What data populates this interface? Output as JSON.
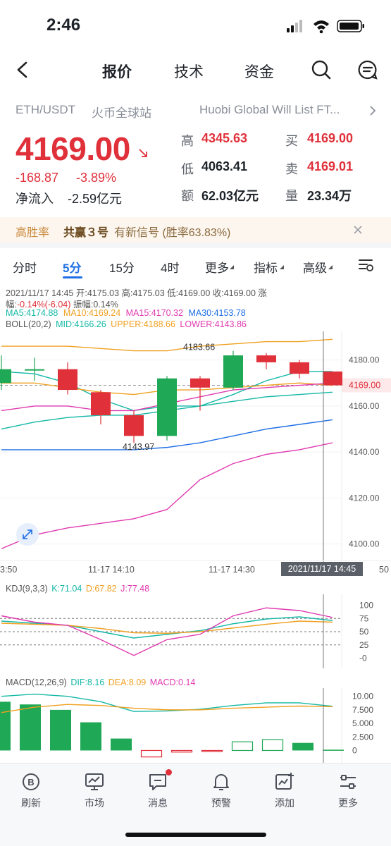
{
  "status": {
    "time": "2:46"
  },
  "nav": {
    "tabs": [
      "报价",
      "技术",
      "资金"
    ]
  },
  "header": {
    "pair": "ETH/USDT",
    "exchange": "火币全球站",
    "news": "Huobi Global Will List FT...",
    "price": "4169.00",
    "change": "-168.87",
    "change_pct": "-3.89%",
    "net_inflow_label": "净流入",
    "net_inflow": "-2.59亿元",
    "stats": {
      "high_label": "高",
      "high": "4345.63",
      "low_label": "低",
      "low": "4063.41",
      "amount_label": "额",
      "amount": "62.03亿元",
      "buy_label": "买",
      "buy": "4169.00",
      "sell_label": "卖",
      "sell": "4169.01",
      "volume_label": "量",
      "volume": "23.34万"
    }
  },
  "signal": {
    "tag": "高胜率",
    "name": "共赢３号",
    "text": "有新信号 (胜率63.83%)"
  },
  "chart_tabs": [
    "分时",
    "5分",
    "15分",
    "4时",
    "更多",
    "指标",
    "高级"
  ],
  "chart_info": {
    "line1": "2021/11/17 14:45 开:4175.03 高:4175.03 低:4169.00 收:4169.00 涨",
    "line2_prefix": "幅:",
    "line2_change": "-0.14%(-6.04)",
    "line2_suffix": " 振幅:0.14%",
    "ma5": "MA5:4174.88",
    "ma10": "MA10:4169.24",
    "ma15": "MA15:4170.32",
    "ma30": "MA30:4153.78",
    "boll": "BOLL(20,2)",
    "mid": "MID:4166.26",
    "upper": "UPPER:4188.66",
    "lower": "LOWER:4143.86",
    "high_mark": "4183.66",
    "low_mark": "4143.97",
    "last_price_tag": "4169.00",
    "time_labels": [
      "3:50",
      "11-17 14:10",
      "11-17 14:30",
      "50"
    ],
    "crosshair_time": "2021/11/17 14:45",
    "kdj": "KDJ(9,3,3)",
    "kdj_k": "K:71.04",
    "kdj_d": "D:67.82",
    "kdj_j": "J:77.48",
    "macd": "MACD(12,26,9)",
    "macd_dif": "DIF:8.16",
    "macd_dea": "DEA:8.09",
    "macd_val": "MACD:0.14"
  },
  "colors": {
    "up": "#1fa855",
    "down": "#e0303a",
    "accent": "#1f6fe5"
  },
  "chart_data": [
    {
      "type": "candlestick",
      "y_axis_ticks": [
        "4180.00",
        "4160.00",
        "4140.00",
        "4120.00",
        "4100.00"
      ],
      "ylim": [
        4095,
        4190
      ],
      "candles": [
        {
          "o": 4170,
          "c": 4176,
          "h": 4182,
          "l": 4167
        },
        {
          "o": 4176,
          "c": 4176,
          "h": 4181,
          "l": 4171
        },
        {
          "o": 4176,
          "c": 4167,
          "h": 4179,
          "l": 4165
        },
        {
          "o": 4166,
          "c": 4156,
          "h": 4167,
          "l": 4152
        },
        {
          "o": 4156,
          "c": 4147,
          "h": 4158,
          "l": 4144
        },
        {
          "o": 4147,
          "c": 4172,
          "h": 4173,
          "l": 4145
        },
        {
          "o": 4172,
          "c": 4168,
          "h": 4173,
          "l": 4158
        },
        {
          "o": 4168,
          "c": 4182,
          "h": 4184,
          "l": 4167
        },
        {
          "o": 4182,
          "c": 4179,
          "h": 4183,
          "l": 4176
        },
        {
          "o": 4179,
          "c": 4174,
          "h": 4180,
          "l": 4172
        },
        {
          "o": 4175,
          "c": 4169,
          "h": 4175,
          "l": 4169
        }
      ],
      "series": [
        {
          "name": "UPPER",
          "values": [
            4186,
            4186,
            4186,
            4185,
            4184,
            4184,
            4186,
            4187,
            4188,
            4188,
            4189
          ]
        },
        {
          "name": "MA5",
          "values": [
            4175,
            4174,
            4170,
            4163,
            4158,
            4160,
            4160,
            4165,
            4171,
            4175,
            4175
          ]
        },
        {
          "name": "MA10",
          "values": [
            4170,
            4170,
            4168,
            4166,
            4165,
            4167,
            4167,
            4168,
            4169,
            4170,
            4169
          ]
        },
        {
          "name": "MA15",
          "values": [
            4158,
            4160,
            4160,
            4158,
            4158,
            4161,
            4164,
            4167,
            4168,
            4169,
            4170
          ]
        },
        {
          "name": "MID",
          "values": [
            4150,
            4153,
            4155,
            4156,
            4156,
            4158,
            4160,
            4162,
            4164,
            4165,
            4166
          ]
        },
        {
          "name": "MA30",
          "values": [
            4141,
            4141,
            4141,
            4141,
            4141,
            4142,
            4144,
            4147,
            4150,
            4152,
            4154
          ]
        },
        {
          "name": "LOWER",
          "values": [
            4098,
            4104,
            4107,
            4109,
            4111,
            4115,
            4128,
            4135,
            4139,
            4141,
            4144
          ]
        }
      ]
    },
    {
      "type": "line",
      "title": "KDJ(9,3,3)",
      "y_axis_ticks": [
        "100",
        "75",
        "50",
        "25",
        "-0"
      ],
      "ylim": [
        -10,
        110
      ],
      "series": [
        {
          "name": "K",
          "values": [
            70,
            66,
            62,
            50,
            38,
            45,
            52,
            65,
            74,
            78,
            71
          ]
        },
        {
          "name": "D",
          "values": [
            66,
            64,
            62,
            56,
            48,
            47,
            50,
            57,
            64,
            70,
            68
          ]
        },
        {
          "name": "J",
          "values": [
            80,
            68,
            62,
            35,
            5,
            35,
            45,
            80,
            95,
            90,
            77
          ]
        }
      ]
    },
    {
      "type": "bar",
      "title": "MACD(12,26,9)",
      "y_axis_ticks": [
        "10.00",
        "7.500",
        "5.000",
        "2.500",
        "0"
      ],
      "ylim": [
        -1.5,
        11
      ],
      "values": [
        9.0,
        8.5,
        7.5,
        5.2,
        2.2,
        -1.2,
        -0.3,
        -0.2,
        1.6,
        2.0,
        1.4,
        0.14
      ],
      "series": [
        {
          "name": "DIF",
          "values": [
            10.0,
            10.4,
            10.0,
            9.0,
            7.2,
            7.3,
            7.6,
            8.3,
            8.8,
            8.8,
            8.16
          ]
        },
        {
          "name": "DEA",
          "values": [
            7.0,
            8.0,
            8.5,
            8.3,
            7.8,
            7.5,
            7.5,
            7.8,
            8.0,
            8.2,
            8.09
          ]
        }
      ]
    }
  ],
  "bottom_nav": [
    {
      "label": "刷新",
      "icon": "refresh-b-icon"
    },
    {
      "label": "市场",
      "icon": "market-monitor-icon"
    },
    {
      "label": "消息",
      "icon": "message-icon"
    },
    {
      "label": "预警",
      "icon": "bell-icon"
    },
    {
      "label": "添加",
      "icon": "add-chart-icon"
    },
    {
      "label": "更多",
      "icon": "more-sliders-icon"
    }
  ]
}
